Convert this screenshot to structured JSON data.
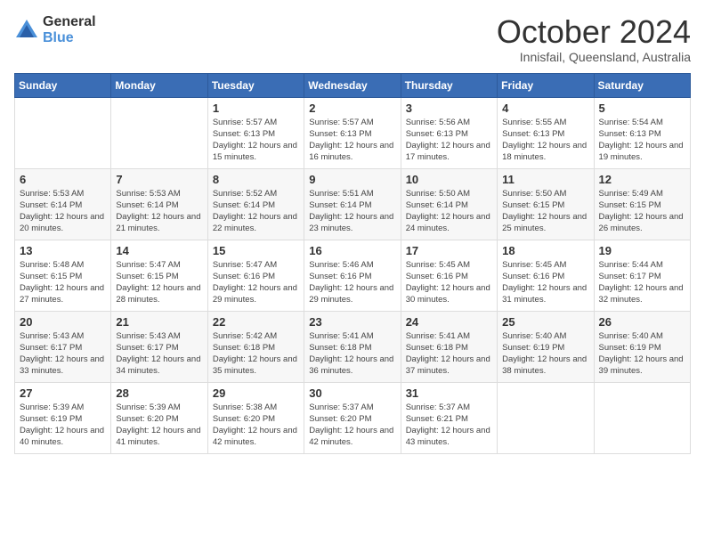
{
  "logo": {
    "text_general": "General",
    "text_blue": "Blue"
  },
  "header": {
    "month_year": "October 2024",
    "location": "Innisfail, Queensland, Australia"
  },
  "weekdays": [
    "Sunday",
    "Monday",
    "Tuesday",
    "Wednesday",
    "Thursday",
    "Friday",
    "Saturday"
  ],
  "weeks": [
    [
      {
        "day": "",
        "info": ""
      },
      {
        "day": "",
        "info": ""
      },
      {
        "day": "1",
        "info": "Sunrise: 5:57 AM\nSunset: 6:13 PM\nDaylight: 12 hours and 15 minutes."
      },
      {
        "day": "2",
        "info": "Sunrise: 5:57 AM\nSunset: 6:13 PM\nDaylight: 12 hours and 16 minutes."
      },
      {
        "day": "3",
        "info": "Sunrise: 5:56 AM\nSunset: 6:13 PM\nDaylight: 12 hours and 17 minutes."
      },
      {
        "day": "4",
        "info": "Sunrise: 5:55 AM\nSunset: 6:13 PM\nDaylight: 12 hours and 18 minutes."
      },
      {
        "day": "5",
        "info": "Sunrise: 5:54 AM\nSunset: 6:13 PM\nDaylight: 12 hours and 19 minutes."
      }
    ],
    [
      {
        "day": "6",
        "info": "Sunrise: 5:53 AM\nSunset: 6:14 PM\nDaylight: 12 hours and 20 minutes."
      },
      {
        "day": "7",
        "info": "Sunrise: 5:53 AM\nSunset: 6:14 PM\nDaylight: 12 hours and 21 minutes."
      },
      {
        "day": "8",
        "info": "Sunrise: 5:52 AM\nSunset: 6:14 PM\nDaylight: 12 hours and 22 minutes."
      },
      {
        "day": "9",
        "info": "Sunrise: 5:51 AM\nSunset: 6:14 PM\nDaylight: 12 hours and 23 minutes."
      },
      {
        "day": "10",
        "info": "Sunrise: 5:50 AM\nSunset: 6:14 PM\nDaylight: 12 hours and 24 minutes."
      },
      {
        "day": "11",
        "info": "Sunrise: 5:50 AM\nSunset: 6:15 PM\nDaylight: 12 hours and 25 minutes."
      },
      {
        "day": "12",
        "info": "Sunrise: 5:49 AM\nSunset: 6:15 PM\nDaylight: 12 hours and 26 minutes."
      }
    ],
    [
      {
        "day": "13",
        "info": "Sunrise: 5:48 AM\nSunset: 6:15 PM\nDaylight: 12 hours and 27 minutes."
      },
      {
        "day": "14",
        "info": "Sunrise: 5:47 AM\nSunset: 6:15 PM\nDaylight: 12 hours and 28 minutes."
      },
      {
        "day": "15",
        "info": "Sunrise: 5:47 AM\nSunset: 6:16 PM\nDaylight: 12 hours and 29 minutes."
      },
      {
        "day": "16",
        "info": "Sunrise: 5:46 AM\nSunset: 6:16 PM\nDaylight: 12 hours and 29 minutes."
      },
      {
        "day": "17",
        "info": "Sunrise: 5:45 AM\nSunset: 6:16 PM\nDaylight: 12 hours and 30 minutes."
      },
      {
        "day": "18",
        "info": "Sunrise: 5:45 AM\nSunset: 6:16 PM\nDaylight: 12 hours and 31 minutes."
      },
      {
        "day": "19",
        "info": "Sunrise: 5:44 AM\nSunset: 6:17 PM\nDaylight: 12 hours and 32 minutes."
      }
    ],
    [
      {
        "day": "20",
        "info": "Sunrise: 5:43 AM\nSunset: 6:17 PM\nDaylight: 12 hours and 33 minutes."
      },
      {
        "day": "21",
        "info": "Sunrise: 5:43 AM\nSunset: 6:17 PM\nDaylight: 12 hours and 34 minutes."
      },
      {
        "day": "22",
        "info": "Sunrise: 5:42 AM\nSunset: 6:18 PM\nDaylight: 12 hours and 35 minutes."
      },
      {
        "day": "23",
        "info": "Sunrise: 5:41 AM\nSunset: 6:18 PM\nDaylight: 12 hours and 36 minutes."
      },
      {
        "day": "24",
        "info": "Sunrise: 5:41 AM\nSunset: 6:18 PM\nDaylight: 12 hours and 37 minutes."
      },
      {
        "day": "25",
        "info": "Sunrise: 5:40 AM\nSunset: 6:19 PM\nDaylight: 12 hours and 38 minutes."
      },
      {
        "day": "26",
        "info": "Sunrise: 5:40 AM\nSunset: 6:19 PM\nDaylight: 12 hours and 39 minutes."
      }
    ],
    [
      {
        "day": "27",
        "info": "Sunrise: 5:39 AM\nSunset: 6:19 PM\nDaylight: 12 hours and 40 minutes."
      },
      {
        "day": "28",
        "info": "Sunrise: 5:39 AM\nSunset: 6:20 PM\nDaylight: 12 hours and 41 minutes."
      },
      {
        "day": "29",
        "info": "Sunrise: 5:38 AM\nSunset: 6:20 PM\nDaylight: 12 hours and 42 minutes."
      },
      {
        "day": "30",
        "info": "Sunrise: 5:37 AM\nSunset: 6:20 PM\nDaylight: 12 hours and 42 minutes."
      },
      {
        "day": "31",
        "info": "Sunrise: 5:37 AM\nSunset: 6:21 PM\nDaylight: 12 hours and 43 minutes."
      },
      {
        "day": "",
        "info": ""
      },
      {
        "day": "",
        "info": ""
      }
    ]
  ]
}
